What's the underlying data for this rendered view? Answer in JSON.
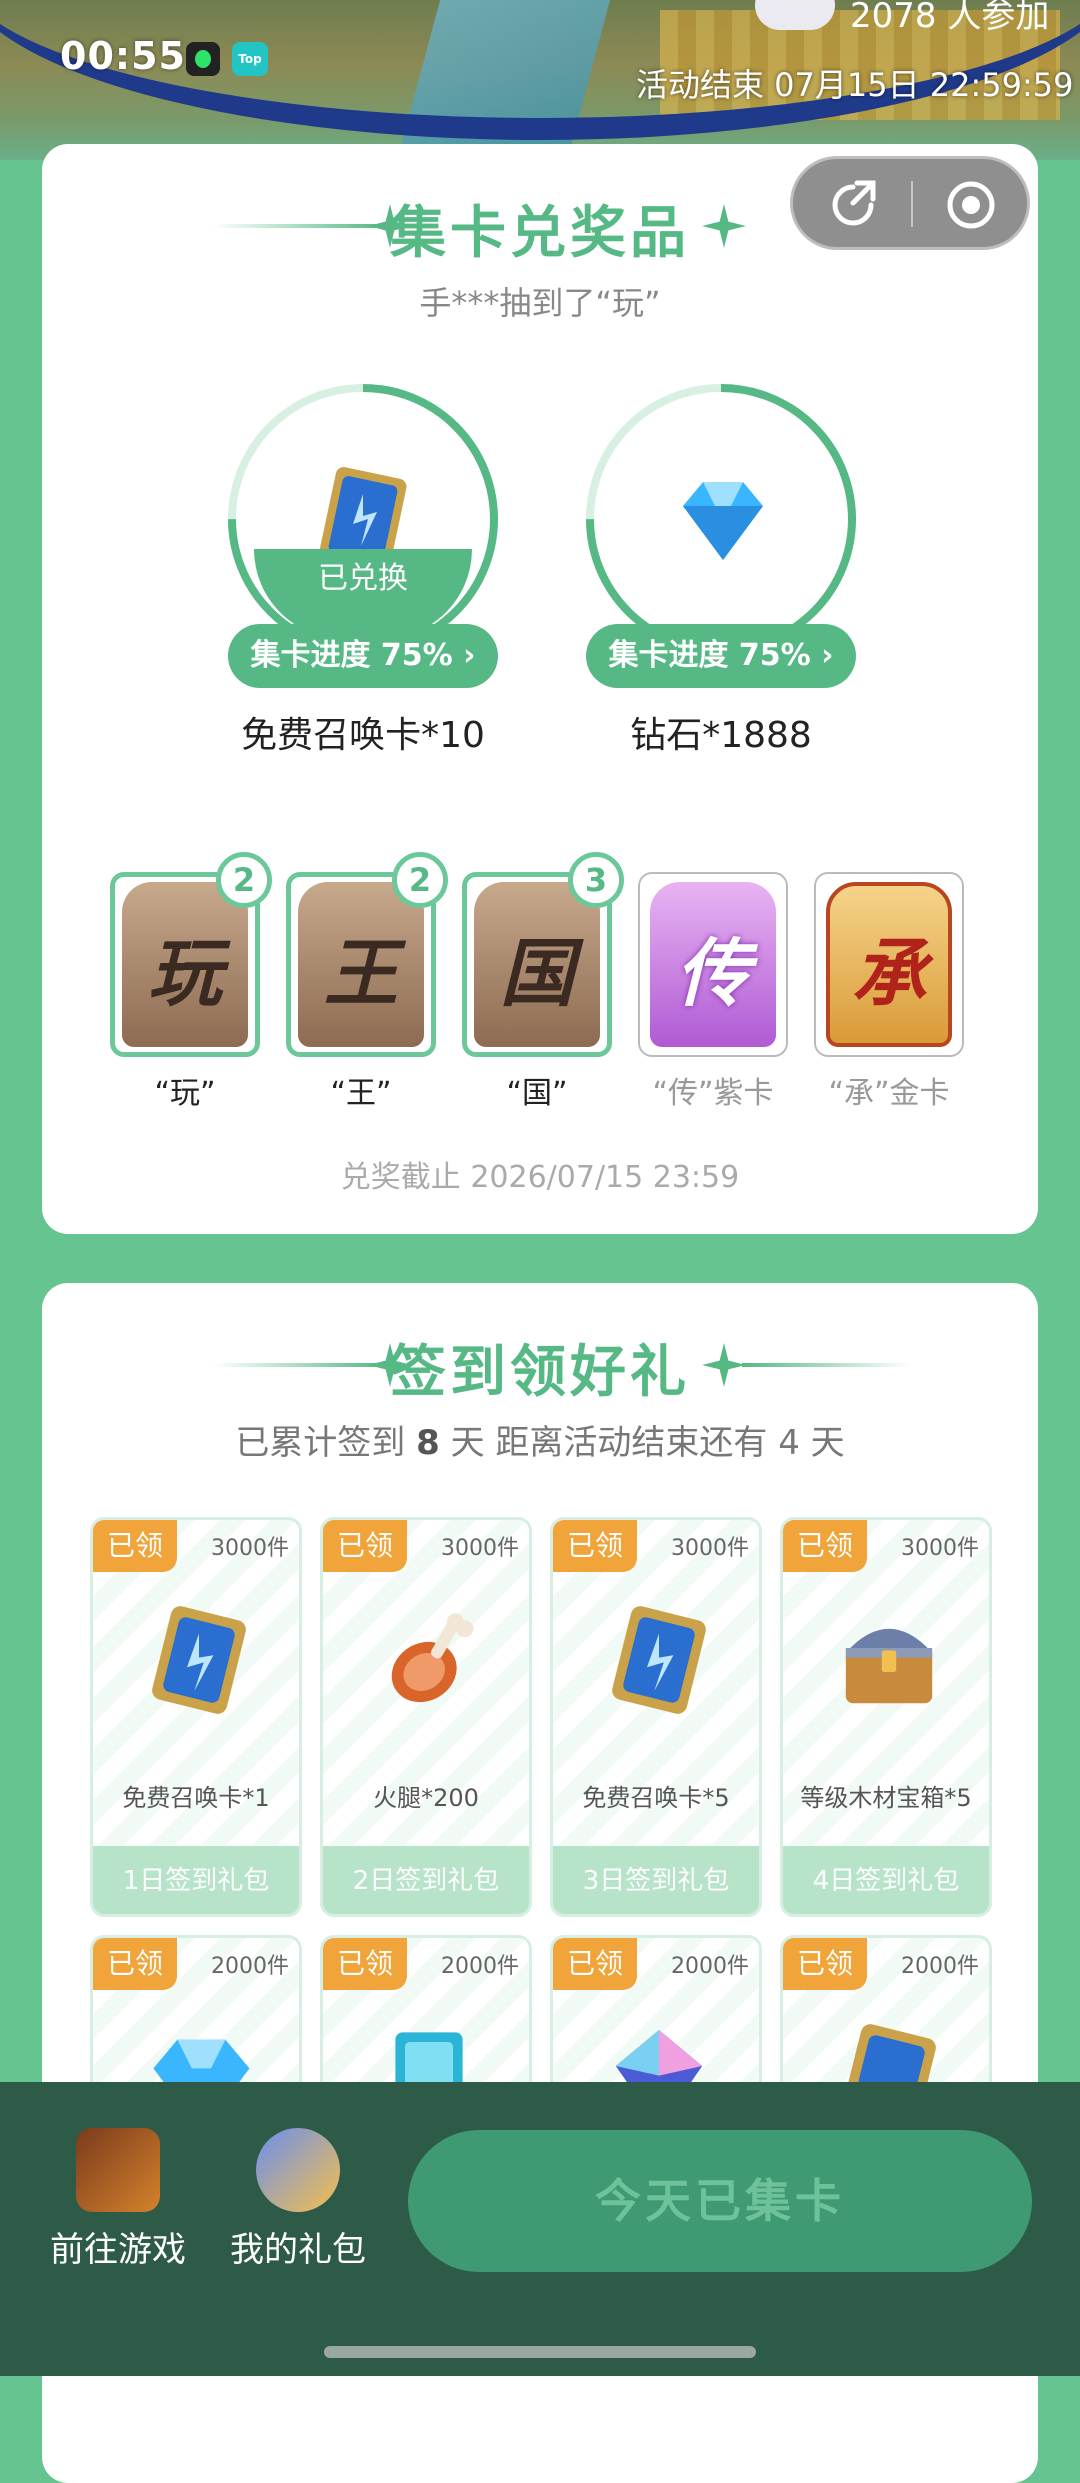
{
  "status_bar": {
    "time": "00:55",
    "app_icon2_text": "Top"
  },
  "header": {
    "participants": "2078 人参加",
    "event_end": "活动结束 07月15日 22:59:59"
  },
  "card_exchange": {
    "title": "集卡兑奖品",
    "ticker": "手***抽到了“玩”",
    "prizes": [
      {
        "name": "免费召唤卡*10",
        "progress_label": "集卡进度 75% ›",
        "progress": 0.75,
        "claimed_label": "已兑换",
        "icon": "summon-card-icon"
      },
      {
        "name": "钻石*1888",
        "progress_label": "集卡进度 75% ›",
        "progress": 0.75,
        "icon": "diamond-icon"
      }
    ],
    "word_cards": [
      {
        "char": "玩",
        "label": "“玩”",
        "count": "2"
      },
      {
        "char": "王",
        "label": "“王”",
        "count": "2"
      },
      {
        "char": "国",
        "label": "“国”",
        "count": "3"
      },
      {
        "char": "传",
        "label": "“传”紫卡"
      },
      {
        "char": "承",
        "label": "“承”金卡"
      }
    ],
    "deadline": "兑奖截止 2026/07/15 23:59"
  },
  "signin": {
    "title": "签到领好礼",
    "stat_prefix": "已累计签到",
    "days_signed": "8",
    "stat_mid": "天  距离活动结束还有 4 天",
    "rewards": [
      {
        "tag": "已领",
        "qty": "3000件",
        "name": "免费召唤卡*1",
        "footer": "1日签到礼包",
        "icon": "summon-card-icon"
      },
      {
        "tag": "已领",
        "qty": "3000件",
        "name": "火腿*200",
        "footer": "2日签到礼包",
        "icon": "ham-icon"
      },
      {
        "tag": "已领",
        "qty": "3000件",
        "name": "免费召唤卡*5",
        "footer": "3日签到礼包",
        "icon": "summon-card-icon"
      },
      {
        "tag": "已领",
        "qty": "3000件",
        "name": "等级木材宝箱*5",
        "footer": "4日签到礼包",
        "icon": "treasure-chest-icon"
      },
      {
        "tag": "已领",
        "qty": "2000件",
        "icon": "diamond-icon"
      },
      {
        "tag": "已领",
        "qty": "2000件",
        "icon": "crystal-card-icon"
      },
      {
        "tag": "已领",
        "qty": "2000件",
        "icon": "gem-icon"
      },
      {
        "tag": "已领",
        "qty": "2000件",
        "icon": "summon-card-icon"
      }
    ]
  },
  "bottom_bar": {
    "go_game": "前往游戏",
    "my_gifts": "我的礼包",
    "collect_button": "今天已集卡"
  },
  "colors": {
    "accent": "#56b985",
    "background": "#66c490",
    "tag": "#f0a43a",
    "bottom_bar": "#2e5b47"
  }
}
